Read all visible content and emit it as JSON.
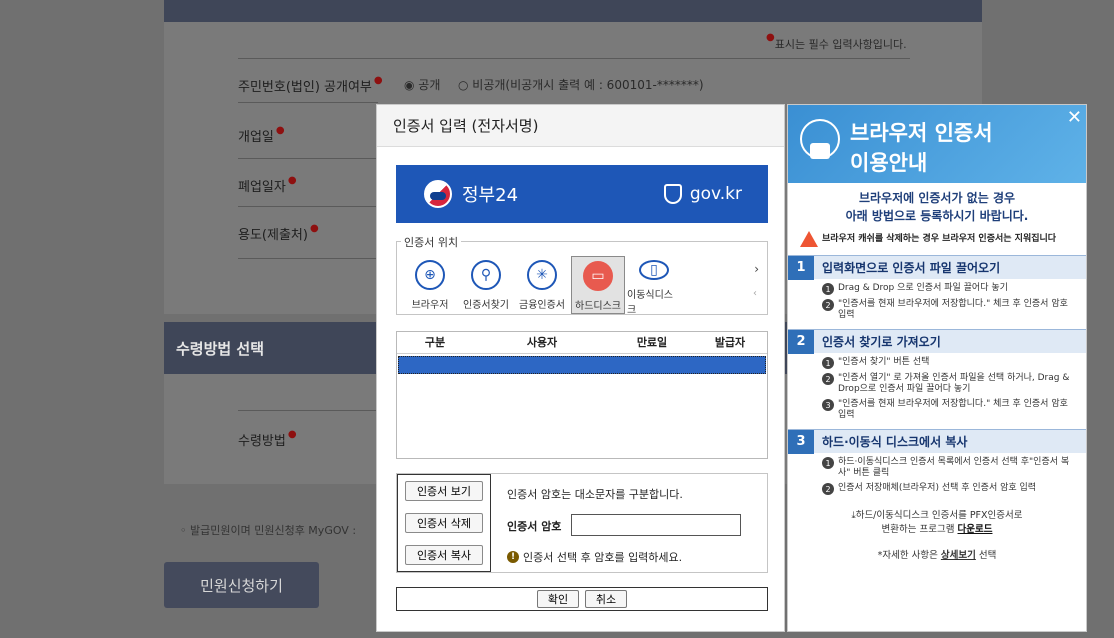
{
  "background": {
    "required_note": "표시는 필수 입력사항입니다.",
    "labels": {
      "id_public": "주민번호(법인) 공개여부",
      "open_date": "개업일",
      "close_date": "폐업일자",
      "purpose": "용도(제출처)",
      "receive_method_section": "수령방법 선택",
      "receive_method": "수령방법"
    },
    "radio_public": "공개",
    "radio_private": "비공개(비공개시 출력 예 : 600101-*******)",
    "footer_note": "발급민원이며 민원신청후 MyGOV :",
    "submit_button": "민원신청하기"
  },
  "dialog": {
    "title": "인증서 입력 (전자서명)",
    "banner_left": "정부24",
    "banner_right": "gov.kr",
    "location_legend": "인증서 위치",
    "locations": [
      "브라우저",
      "인증서찾기",
      "금융인증서",
      "하드디스크",
      "이동식디스크"
    ],
    "table_headers": [
      "구분",
      "사용자",
      "만료일",
      "발급자"
    ],
    "buttons": {
      "view": "인증서 보기",
      "delete": "인증서 삭제",
      "copy": "인증서 복사",
      "ok": "확인",
      "cancel": "취소"
    },
    "pw_note": "인증서 암호는 대소문자를 구분합니다.",
    "pw_label": "인증서 암호",
    "pw_hint": "인증서 선택 후 암호를 입력하세요."
  },
  "help": {
    "title1": "브라우저 인증서",
    "title2": "이용안내",
    "sub1": "브라우저에 인증서가 없는 경우",
    "sub2": "아래 방법으로 등록하시기 바랍니다.",
    "warning": "브라우저 캐쉬를 삭제하는 경우 브라우저 인증서는 지워집니다",
    "sections": [
      {
        "num": "1",
        "title": "입력화면으로 인증서 파일 끌어오기",
        "items": [
          "Drag & Drop 으로 인증서 파일 끌어다 놓기",
          "\"인증서를 현재 브라우저에 저장합니다.\" 체크 후 인증서 암호 입력"
        ]
      },
      {
        "num": "2",
        "title": "인증서 찾기로 가져오기",
        "items": [
          "\"인증서 찾기\" 버튼 선택",
          "\"인증서 열기\" 로 가져올 인증서 파일을 선택 하거나, Drag & Drop으로 인증서 파일 끌어다 놓기",
          "\"인증서를 현재 브라우저에 저장합니다.\" 체크 후 인증서 암호 입력"
        ]
      },
      {
        "num": "3",
        "title": "하드·이동식 디스크에서 복사",
        "items": [
          "하드·이동식디스크 인증서 목록에서 인증서 선택 후\"인증서 복사\" 버튼 클릭",
          "인증서 저장매체(브라우저) 선택 후 인증서 암호 입력"
        ]
      }
    ],
    "download_note1": "하드/이동식디스크 인증서를 PFX인증서로",
    "download_note2": "변환하는 프로그램",
    "download_link": "다운로드",
    "more_prefix": "*자세한 사항은",
    "more_link": "상세보기",
    "more_suffix": "선택"
  }
}
